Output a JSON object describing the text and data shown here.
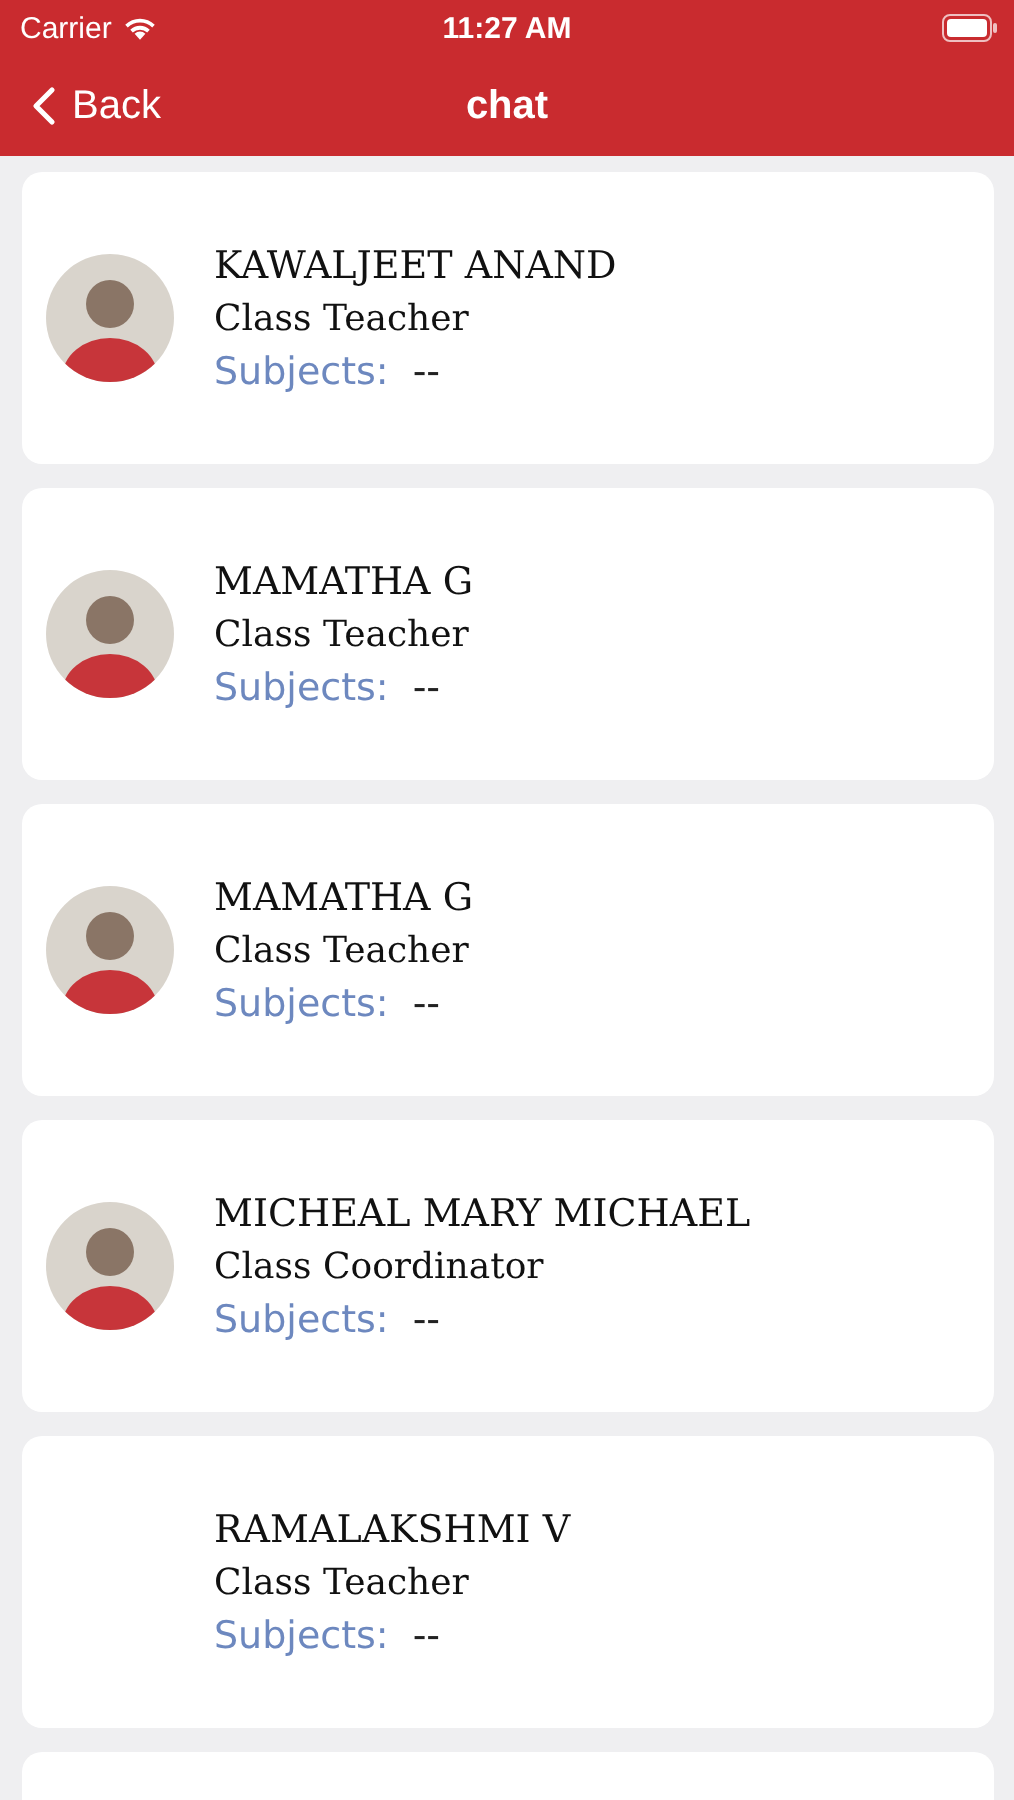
{
  "status_bar": {
    "carrier": "Carrier",
    "time": "11:27 AM"
  },
  "nav_bar": {
    "back_label": "Back",
    "title": "chat"
  },
  "teachers": [
    {
      "name": "KAWALJEET ANAND",
      "role": "Class Teacher",
      "subjects_label": "Subjects:",
      "subjects": "--",
      "has_photo": true
    },
    {
      "name": "MAMATHA G",
      "role": "Class Teacher",
      "subjects_label": "Subjects:",
      "subjects": "--",
      "has_photo": true
    },
    {
      "name": "MAMATHA G",
      "role": "Class Teacher",
      "subjects_label": "Subjects:",
      "subjects": "--",
      "has_photo": true
    },
    {
      "name": "MICHEAL MARY MICHAEL",
      "role": "Class Coordinator",
      "subjects_label": "Subjects:",
      "subjects": "--",
      "has_photo": true
    },
    {
      "name": "RAMALAKSHMI V",
      "role": "Class Teacher",
      "subjects_label": "Subjects:",
      "subjects": "--",
      "has_photo": false
    }
  ]
}
